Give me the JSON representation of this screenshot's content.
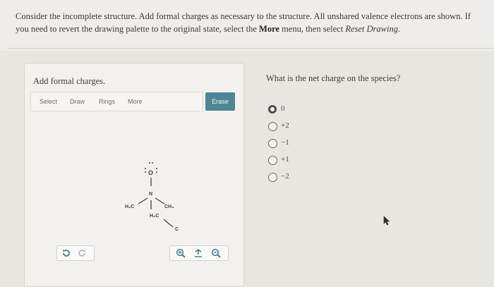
{
  "instructions": {
    "part1": "Consider the incomplete structure. Add formal charges as necessary to the structure. All unshared valence electrons are shown. If you need to revert the drawing palette to the original state, select the ",
    "more_word": "More",
    "part2": " menu, then select ",
    "reset_drawing": "Reset Drawing",
    "part3": "."
  },
  "panel": {
    "title": "Add formal charges.",
    "toolbar": {
      "select": "Select",
      "draw": "Draw",
      "rings": "Rings",
      "more": "More",
      "erase": "Erase"
    },
    "structure": {
      "oxygen": "O",
      "nitrogen": "N",
      "left_group": "H₃C",
      "right_group": "CH₃",
      "lower_group": "H₃C",
      "carbon": "C"
    },
    "undo_icon": "undo-icon",
    "redo_icon": "redo-icon",
    "zoom_in_icon": "zoom-in-icon",
    "reset_icon": "reset-icon",
    "zoom_out_icon": "zoom-out-icon"
  },
  "question": {
    "text": "What is the net charge on the species?",
    "options": [
      {
        "label": "0",
        "selected": true
      },
      {
        "label": "+2",
        "selected": false
      },
      {
        "label": "−1",
        "selected": false
      },
      {
        "label": "+1",
        "selected": false
      },
      {
        "label": "−2",
        "selected": false
      }
    ]
  },
  "colors": {
    "erase_button": "#4f8695",
    "background": "#e9e6e1",
    "panel": "#f3f1ee",
    "icon_teal": "#3f7f8c"
  }
}
